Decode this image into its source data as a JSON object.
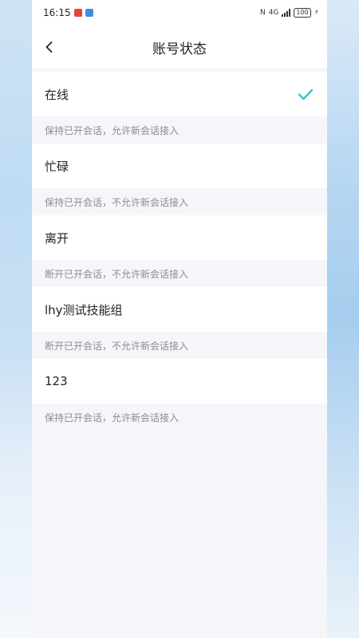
{
  "status_bar": {
    "time": "16:15",
    "network": "4G",
    "battery": "100"
  },
  "header": {
    "back_icon": "chevron-left-icon",
    "title": "账号状态"
  },
  "statuses": [
    {
      "label": "在线",
      "description": "保持已开会话，允许新会话接入",
      "selected": true
    },
    {
      "label": "忙碌",
      "description": "保持已开会话，不允许新会话接入",
      "selected": false
    },
    {
      "label": "离开",
      "description": "断开已开会话，不允许新会话接入",
      "selected": false
    },
    {
      "label": "lhy测试技能组",
      "description": "断开已开会话，不允许新会话接入",
      "selected": false
    },
    {
      "label": "123",
      "description": "保持已开会话，允许新会话接入",
      "selected": false
    }
  ],
  "colors": {
    "accent": "#34c7c9",
    "background": "#f5f6fa"
  }
}
